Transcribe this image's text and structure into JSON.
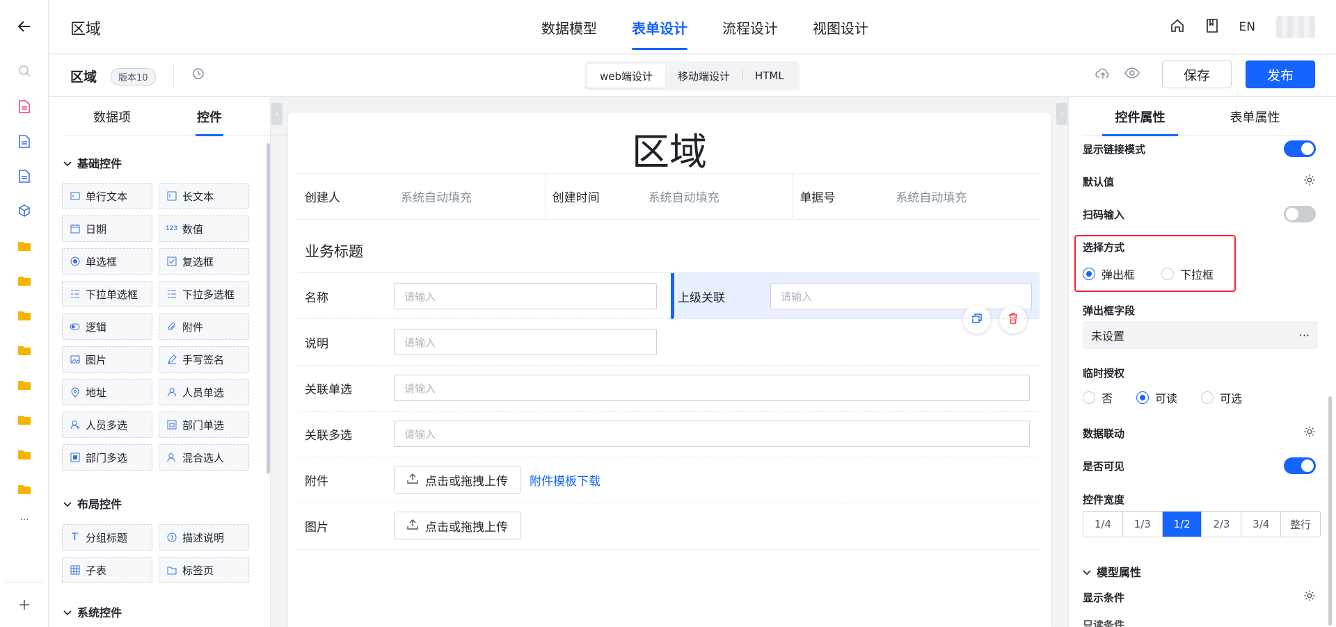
{
  "header": {
    "app_title": "区域",
    "nav_tabs": [
      "数据模型",
      "表单设计",
      "流程设计",
      "视图设计"
    ],
    "active_nav": 1,
    "lang": "EN"
  },
  "subheader": {
    "form_name": "区域",
    "version": "版本10",
    "modes": [
      "web端设计",
      "移动端设计",
      "HTML"
    ],
    "active_mode": 0,
    "save_label": "保存",
    "publish_label": "发布"
  },
  "left_panel": {
    "tabs": [
      "数据项",
      "控件"
    ],
    "active_tab": 1,
    "sections": [
      {
        "title": "基础控件",
        "items": [
          {
            "label": "单行文本",
            "icon": "text-input-icon"
          },
          {
            "label": "长文本",
            "icon": "textarea-icon"
          },
          {
            "label": "日期",
            "icon": "calendar-icon"
          },
          {
            "label": "数值",
            "icon": "number-icon"
          },
          {
            "label": "单选框",
            "icon": "radio-icon"
          },
          {
            "label": "复选框",
            "icon": "checkbox-icon"
          },
          {
            "label": "下拉单选框",
            "icon": "dropdown-single-icon"
          },
          {
            "label": "下拉多选框",
            "icon": "dropdown-multi-icon"
          },
          {
            "label": "逻辑",
            "icon": "toggle-icon"
          },
          {
            "label": "附件",
            "icon": "paperclip-icon"
          },
          {
            "label": "图片",
            "icon": "image-icon"
          },
          {
            "label": "手写签名",
            "icon": "pen-icon"
          },
          {
            "label": "地址",
            "icon": "location-icon"
          },
          {
            "label": "人员单选",
            "icon": "user-icon"
          },
          {
            "label": "人员多选",
            "icon": "users-icon"
          },
          {
            "label": "部门单选",
            "icon": "department-icon"
          },
          {
            "label": "部门多选",
            "icon": "departments-icon"
          },
          {
            "label": "混合选人",
            "icon": "user-mixed-icon"
          }
        ]
      },
      {
        "title": "布局控件",
        "items": [
          {
            "label": "分组标题",
            "icon": "title-icon"
          },
          {
            "label": "描述说明",
            "icon": "question-icon"
          },
          {
            "label": "子表",
            "icon": "table-icon"
          },
          {
            "label": "标签页",
            "icon": "tabs-icon"
          }
        ]
      },
      {
        "title": "系统控件",
        "items": []
      }
    ]
  },
  "canvas": {
    "title": "区域",
    "info": [
      {
        "label": "创建人",
        "value": "系统自动填充"
      },
      {
        "label": "创建时间",
        "value": "系统自动填充"
      },
      {
        "label": "单据号",
        "value": "系统自动填充"
      }
    ],
    "business_title": "业务标题",
    "fields": {
      "name": {
        "label": "名称",
        "placeholder": "请输入"
      },
      "parent": {
        "label": "上级关联",
        "placeholder": "请输入"
      },
      "desc": {
        "label": "说明",
        "placeholder": "请输入"
      },
      "rel_single": {
        "label": "关联单选",
        "placeholder": "请输入"
      },
      "rel_multi": {
        "label": "关联多选",
        "placeholder": "请输入"
      },
      "attachment": {
        "label": "附件",
        "upload": "点击或拖拽上传",
        "template_link": "附件模板下载"
      },
      "image": {
        "label": "图片",
        "upload": "点击或拖拽上传"
      }
    }
  },
  "right_panel": {
    "tabs": [
      "控件属性",
      "表单属性"
    ],
    "active_tab": 0,
    "show_link_mode": {
      "label": "显示链接模式",
      "on": true
    },
    "default_value": "默认值",
    "scan_input": {
      "label": "扫码输入",
      "on": false
    },
    "select_mode": {
      "label": "选择方式",
      "options": [
        "弹出框",
        "下拉框"
      ],
      "selected": 0
    },
    "popup_fields": {
      "label": "弹出框字段",
      "value": "未设置",
      "more": "···"
    },
    "temp_auth": {
      "label": "临时授权",
      "options": [
        "否",
        "可读",
        "可选"
      ],
      "selected": 1
    },
    "data_link": "数据联动",
    "visible": {
      "label": "是否可见",
      "on": true
    },
    "width": {
      "label": "控件宽度",
      "options": [
        "1/4",
        "1/3",
        "1/2",
        "2/3",
        "3/4",
        "整行"
      ],
      "selected": 2
    },
    "model_props": "模型属性",
    "display_cond": "显示条件",
    "cut_off_label": "只读条件"
  },
  "colors": {
    "accent": "#1664ff",
    "highlight": "#f5222d",
    "delete": "#f53f3f"
  }
}
